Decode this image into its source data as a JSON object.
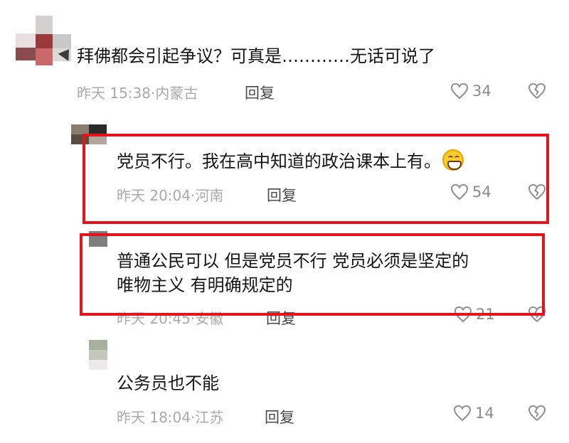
{
  "comments": [
    {
      "text": "拜佛都会引起争议？可真是…………无话可说了",
      "time": "昨天 15:38",
      "location": "内蒙古",
      "reply_label": "回复",
      "likes": "34",
      "like_icon": "heart-icon",
      "dislike_icon": "broken-heart-icon"
    }
  ],
  "replies": [
    {
      "text": "党员不行。我在高中知道的政治课本上有。",
      "emoji": "grinning-face-icon",
      "time": "昨天 20:04",
      "location": "河南",
      "reply_label": "回复",
      "likes": "54"
    },
    {
      "text_line1": "普通公民可以  但是党员不行   党员必须是坚定的",
      "text_line2": "唯物主义  有明确规定的",
      "time": "昨天 20:45",
      "location": "安徽",
      "reply_label": "回复",
      "likes": "21"
    },
    {
      "text": "公务员也不能",
      "time": "昨天 18:04",
      "location": "江苏",
      "reply_label": "回复",
      "likes": "14"
    }
  ],
  "colors": {
    "highlight_border": "#e3141a",
    "meta_text": "#a9a9a9",
    "reply_text": "#4a4a4a"
  }
}
